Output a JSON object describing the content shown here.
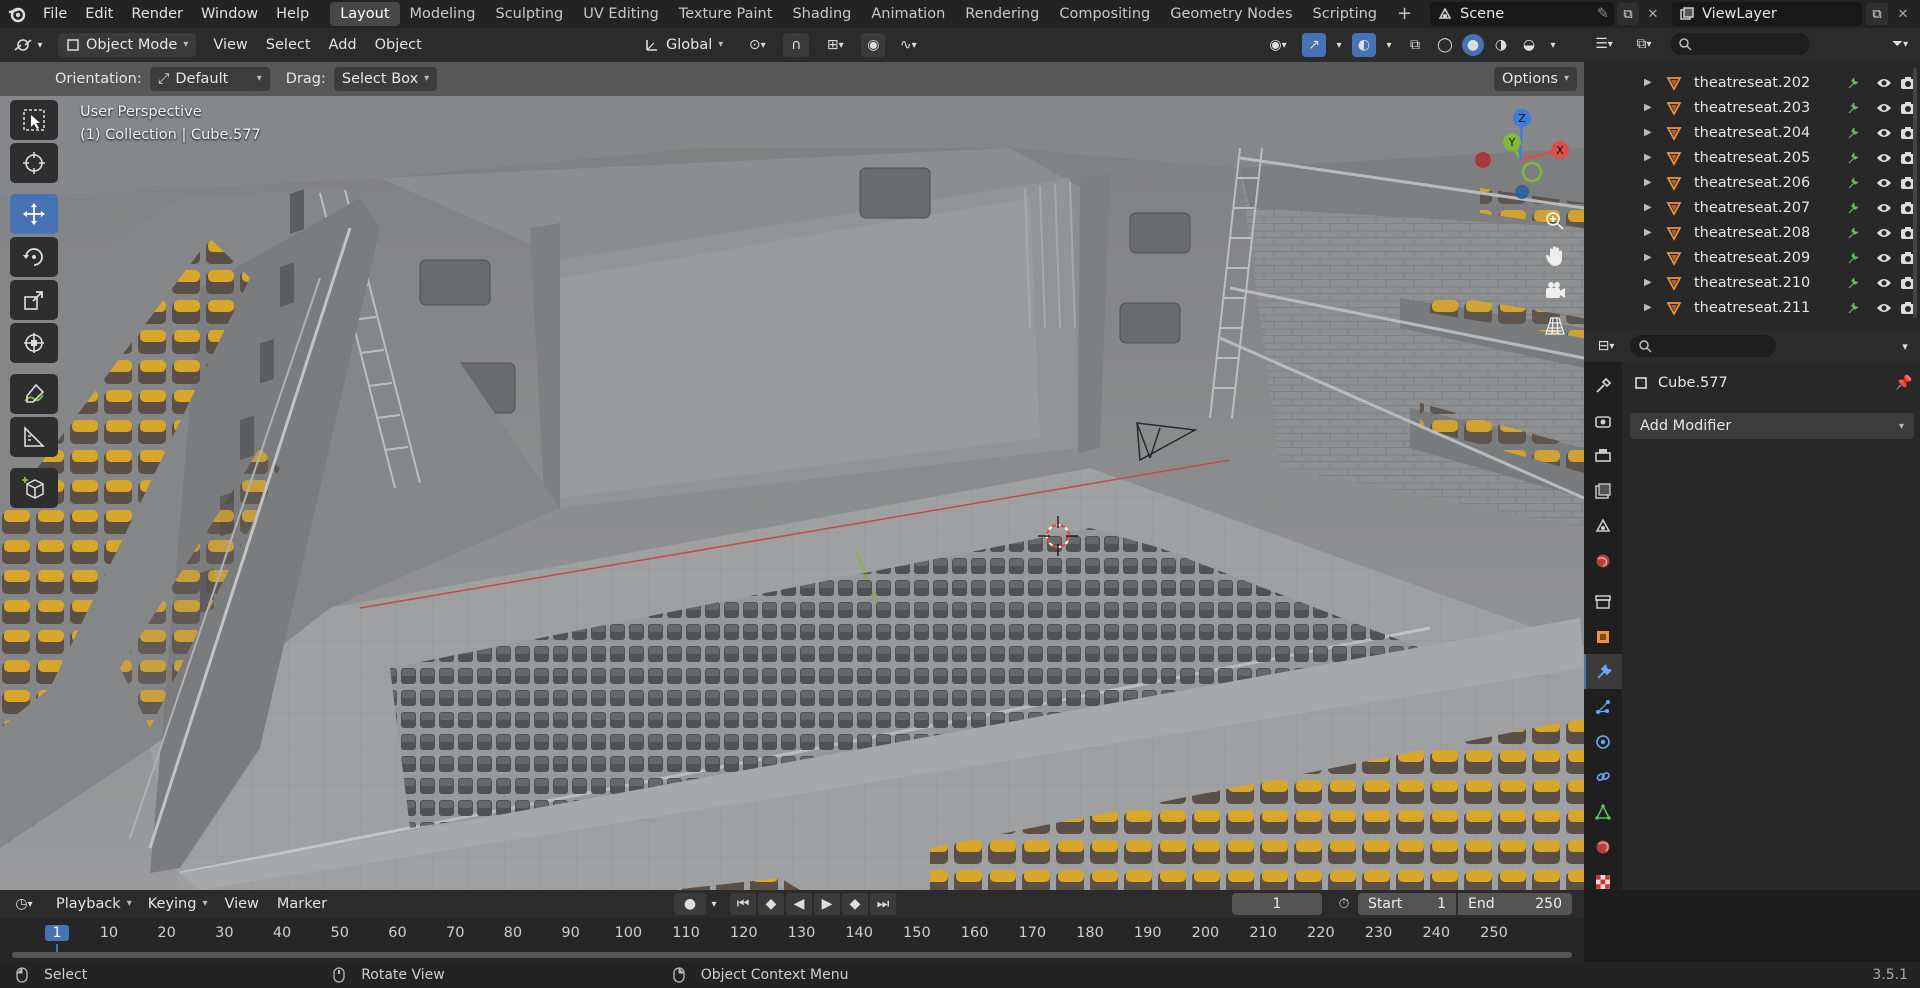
{
  "app": {
    "menu": [
      "File",
      "Edit",
      "Render",
      "Window",
      "Help"
    ],
    "workspaces": [
      "Layout",
      "Modeling",
      "Sculpting",
      "UV Editing",
      "Texture Paint",
      "Shading",
      "Animation",
      "Rendering",
      "Compositing",
      "Geometry Nodes",
      "Scripting"
    ],
    "add_workspace": "+",
    "scene": "Scene",
    "view_layer": "ViewLayer",
    "version": "3.5.1"
  },
  "viewport": {
    "mode": "Object Mode",
    "header_menu": [
      "View",
      "Select",
      "Add",
      "Object"
    ],
    "transform_orientation": "Global",
    "orientation_label": "Orientation:",
    "orientation_value": "Default",
    "drag_label": "Drag:",
    "drag_value": "Select Box",
    "options_label": "Options",
    "perspective": "User Perspective",
    "collection_info": "(1) Collection | Cube.577",
    "gizmo_axes": {
      "x": "X",
      "y": "Y",
      "z": "Z"
    }
  },
  "outliner": {
    "items": [
      "theatreseat.202",
      "theatreseat.203",
      "theatreseat.204",
      "theatreseat.205",
      "theatreseat.206",
      "theatreseat.207",
      "theatreseat.208",
      "theatreseat.209",
      "theatreseat.210",
      "theatreseat.211"
    ]
  },
  "properties": {
    "object_name": "Cube.577",
    "add_modifier": "Add Modifier"
  },
  "timeline": {
    "menu": [
      "Playback",
      "Keying",
      "View",
      "Marker"
    ],
    "current_frame": "1",
    "start_label": "Start",
    "start_value": "1",
    "end_label": "End",
    "end_value": "250",
    "ruler": [
      "1",
      "10",
      "20",
      "30",
      "40",
      "50",
      "60",
      "70",
      "80",
      "90",
      "100",
      "110",
      "120",
      "130",
      "140",
      "150",
      "160",
      "170",
      "180",
      "190",
      "200",
      "210",
      "220",
      "230",
      "240",
      "250"
    ]
  },
  "status": {
    "select": "Select",
    "rotate": "Rotate View",
    "context": "Object Context Menu"
  },
  "colors": {
    "accent": "#4772b3",
    "seat_yellow": "#d9a62c",
    "seat_dark": "#4a4a4a",
    "axis_x": "#e04b4b",
    "axis_y": "#7fb83a",
    "axis_z": "#3e7ed9",
    "mesh_orange": "#f0903a"
  }
}
